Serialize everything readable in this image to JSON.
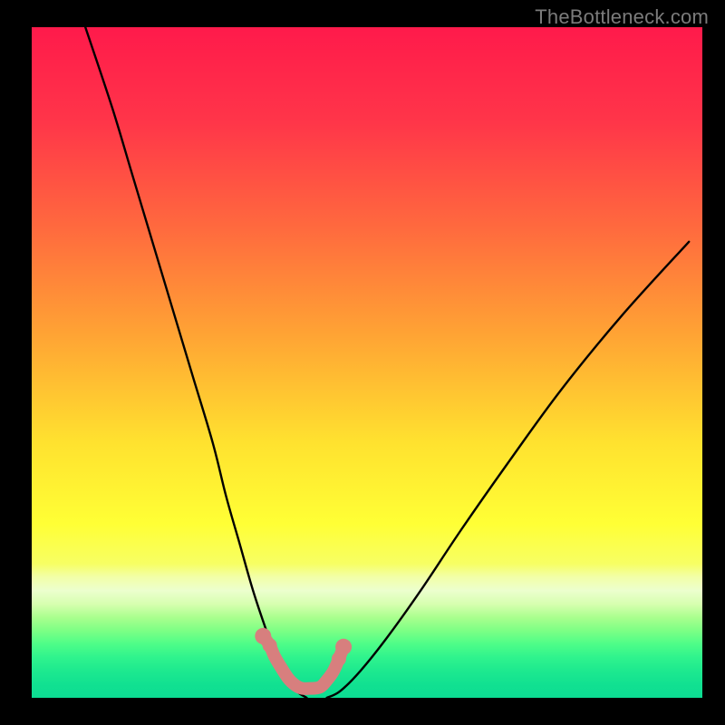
{
  "watermark": "TheBottleneck.com",
  "chart_data": {
    "type": "line",
    "title": "",
    "xlabel": "",
    "ylabel": "",
    "xlim": [
      0,
      100
    ],
    "ylim": [
      0,
      100
    ],
    "series": [
      {
        "name": "left-curve",
        "x": [
          8,
          12,
          15,
          18,
          21,
          24,
          27,
          29,
          31,
          33,
          35,
          36.5,
          38,
          39.5,
          41
        ],
        "y": [
          100,
          88,
          78,
          68,
          58,
          48,
          38,
          30,
          23,
          16,
          10,
          6,
          3,
          1,
          0
        ]
      },
      {
        "name": "right-curve",
        "x": [
          44,
          46,
          49,
          53,
          58,
          64,
          71,
          79,
          88,
          98
        ],
        "y": [
          0,
          1,
          4,
          9,
          16,
          25,
          35,
          46,
          57,
          68
        ]
      },
      {
        "name": "floor-squiggle",
        "x": [
          34.5,
          35.5,
          36.2,
          37.2,
          38.5,
          40,
          41.5,
          43,
          44,
          45,
          45.8,
          46.5
        ],
        "y": [
          9.2,
          7.8,
          6.2,
          4.5,
          2.6,
          1.5,
          1.4,
          1.6,
          2.6,
          4.0,
          5.8,
          7.6
        ]
      }
    ],
    "gradient_stops": [
      {
        "pct": 0,
        "color": "#ff1a4b"
      },
      {
        "pct": 14,
        "color": "#ff3549"
      },
      {
        "pct": 30,
        "color": "#ff6a3e"
      },
      {
        "pct": 46,
        "color": "#ffa434"
      },
      {
        "pct": 62,
        "color": "#ffe22f"
      },
      {
        "pct": 74,
        "color": "#ffff35"
      },
      {
        "pct": 80,
        "color": "#f7ff63"
      },
      {
        "pct": 82,
        "color": "#f2ffa8"
      },
      {
        "pct": 84,
        "color": "#ecffce"
      },
      {
        "pct": 86,
        "color": "#d7ffb0"
      },
      {
        "pct": 88,
        "color": "#aaff8e"
      },
      {
        "pct": 90,
        "color": "#7cff85"
      },
      {
        "pct": 92,
        "color": "#4dfd88"
      },
      {
        "pct": 94,
        "color": "#2ff38d"
      },
      {
        "pct": 96,
        "color": "#1de98f"
      },
      {
        "pct": 98,
        "color": "#11e191"
      },
      {
        "pct": 100,
        "color": "#0cdc92"
      }
    ],
    "marker_color": "#d77f7e",
    "curve_color": "#000000"
  }
}
